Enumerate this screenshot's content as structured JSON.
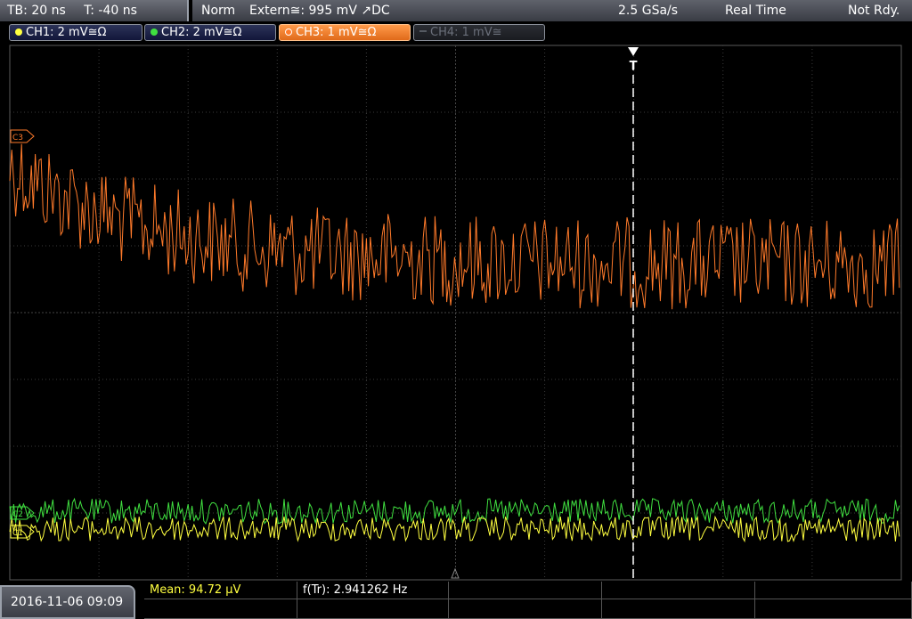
{
  "topbar": {
    "timebase": "TB: 20 ns",
    "trigger_time": "T: -40 ns",
    "mode": "Norm",
    "trigger_source": "Extern≅: 995 mV ↗DC",
    "sample_rate": "2.5 GSa/s",
    "acq_mode": "Real Time",
    "state": "Not Rdy."
  },
  "channels": [
    {
      "label": "CH1: 2 mV≅Ω",
      "color": "#ffff40",
      "state": "on"
    },
    {
      "label": "CH2: 2 mV≅Ω",
      "color": "#40e040",
      "state": "on"
    },
    {
      "label": "CH3: 1 mV≅Ω",
      "color": "#ff7a2a",
      "state": "active"
    },
    {
      "label": "CH4: 1 mV≅",
      "color": "#6a6f7a",
      "state": "off"
    }
  ],
  "markers": {
    "ch3": "C3",
    "ch2": "C2",
    "ch1": "C1",
    "trigger": "T"
  },
  "bottom": {
    "datetime": "2016-11-06 09:09",
    "mean": "Mean: 94.72 µV",
    "freq": "f(Tr): 2.941262 Hz"
  }
}
